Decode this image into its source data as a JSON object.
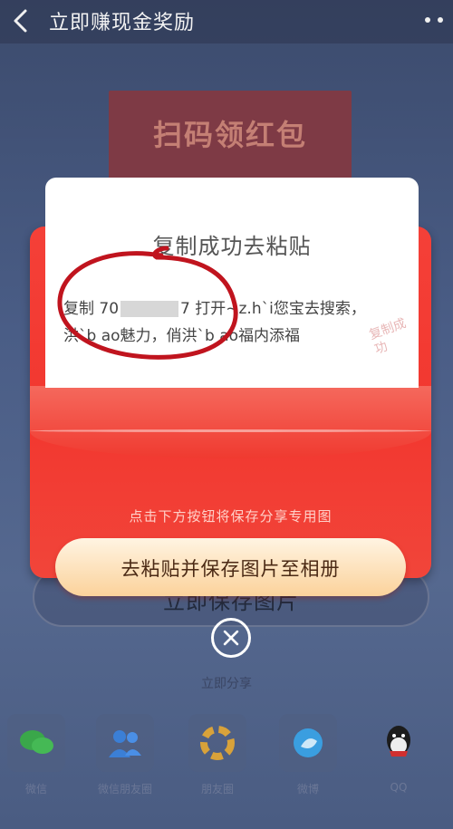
{
  "header": {
    "title": "立即赚现金奖励",
    "back_icon": "chevron-left-icon",
    "more_icon": "more-dots-icon"
  },
  "background": {
    "poster_title": "扫码领红包",
    "save_button_label": "立即保存图片",
    "share_title": "立即分享",
    "share_items": [
      {
        "label": "微信",
        "icon": "wechat-icon",
        "color": "#3aa74a"
      },
      {
        "label": "微信朋友圈",
        "icon": "contacts-icon",
        "color": "#3b7fd6"
      },
      {
        "label": "朋友圈",
        "icon": "moments-icon",
        "color": "#d8a23a"
      },
      {
        "label": "微博",
        "icon": "weibo-icon",
        "color": "#3a9ee0"
      },
      {
        "label": "QQ",
        "icon": "qq-icon",
        "color": "#222222"
      }
    ]
  },
  "modal": {
    "title": "复制成功去粘贴",
    "copy_text_prefix": "复制 70",
    "copy_text_suffix": "7 打开~z.h`i您宝去搜索，",
    "copy_text_line2": "洪`b ao魅力，俏洪`b ao福内添福",
    "stamp_text": "复制成功",
    "hint": "点击下方按钮将保存分享专用图",
    "main_button_label": "去粘贴并保存图片至相册",
    "close_icon": "close-icon"
  },
  "colors": {
    "envelope_red": "#f2372f",
    "button_gold": "#fbd29b",
    "annotation_circle": "#c0141e"
  }
}
